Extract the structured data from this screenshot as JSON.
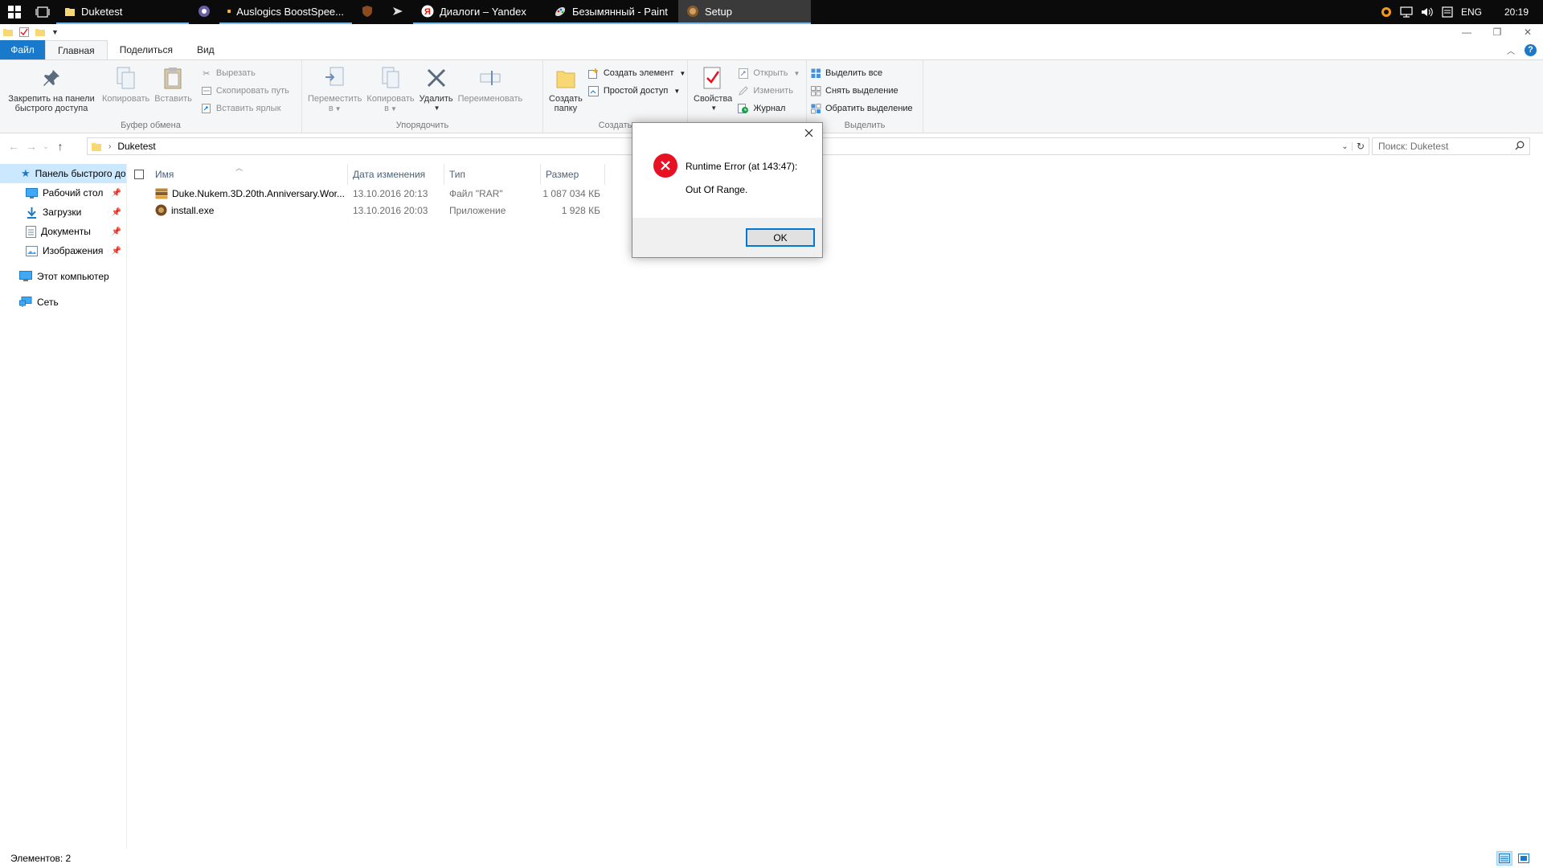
{
  "taskbar": {
    "items": [
      {
        "label": "Duketest",
        "icon": "folder-icon",
        "state": "running"
      },
      {
        "label": "",
        "icon": "app-circle-icon",
        "state": "pinned"
      },
      {
        "label": "Auslogics BoostSpee...",
        "icon": "boostspeed-icon",
        "state": "running"
      },
      {
        "label": "",
        "icon": "app-shield-icon",
        "state": "pinned"
      },
      {
        "label": "",
        "icon": "app-plane-icon",
        "state": "pinned"
      },
      {
        "label": "Диалоги – Yandex",
        "icon": "yandex-icon",
        "state": "running"
      },
      {
        "label": "Безымянный - Paint",
        "icon": "paint-icon",
        "state": "running"
      },
      {
        "label": "Setup",
        "icon": "setup-icon",
        "state": "active"
      }
    ],
    "tray": {
      "language": "ENG",
      "time": "20:19"
    }
  },
  "ribbon": {
    "tabs": {
      "file": "Файл",
      "home": "Главная",
      "share": "Поделиться",
      "view": "Вид"
    },
    "clipboard": {
      "label": "Буфер обмена",
      "pin_line1": "Закрепить на панели",
      "pin_line2": "быстрого доступа",
      "copy": "Копировать",
      "paste": "Вставить",
      "cut": "Вырезать",
      "copy_path": "Скопировать путь",
      "paste_shortcut": "Вставить ярлык"
    },
    "organize": {
      "label": "Упорядочить",
      "move_line1": "Переместить",
      "move_line2": "в",
      "copy_line1": "Копировать",
      "copy_line2": "в",
      "delete": "Удалить",
      "rename": "Переименовать"
    },
    "create": {
      "label": "Создать",
      "new_folder_line1": "Создать",
      "new_folder_line2": "папку",
      "new_item": "Создать элемент",
      "easy_access": "Простой доступ"
    },
    "open": {
      "properties": "Свойства",
      "open": "Открыть",
      "edit": "Изменить",
      "history": "Журнал"
    },
    "select": {
      "label": "Выделить",
      "select_all": "Выделить все",
      "select_none": "Снять выделение",
      "invert": "Обратить выделение"
    }
  },
  "address": {
    "path": "Duketest",
    "search_placeholder": "Поиск: Duketest"
  },
  "navpane": {
    "items": [
      {
        "label": "Панель быстрого доступа",
        "icon": "star-icon",
        "pinned": false
      },
      {
        "label": "Рабочий стол",
        "icon": "desktop-icon",
        "pinned": true
      },
      {
        "label": "Загрузки",
        "icon": "download-icon",
        "pinned": true
      },
      {
        "label": "Документы",
        "icon": "documents-icon",
        "pinned": true
      },
      {
        "label": "Изображения",
        "icon": "pictures-icon",
        "pinned": true
      },
      {
        "label": "Этот компьютер",
        "icon": "computer-icon",
        "pinned": false
      },
      {
        "label": "Сеть",
        "icon": "network-icon",
        "pinned": false
      }
    ]
  },
  "filelist": {
    "columns": {
      "name": "Имя",
      "date": "Дата изменения",
      "type": "Тип",
      "size": "Размер"
    },
    "rows": [
      {
        "name": "Duke.Nukem.3D.20th.Anniversary.Wor...",
        "date": "13.10.2016 20:13",
        "type": "Файл \"RAR\"",
        "size": "1 087 034 КБ",
        "icon": "rar-archive-icon"
      },
      {
        "name": "install.exe",
        "date": "13.10.2016 20:03",
        "type": "Приложение",
        "size": "1 928 КБ",
        "icon": "exe-app-icon"
      }
    ]
  },
  "statusbar": {
    "count": "Элементов: 2"
  },
  "dialog": {
    "message_line1": "Runtime Error (at 143:47):",
    "message_line2": "Out Of Range.",
    "ok_label": "OK",
    "icon": "error-icon"
  },
  "colors": {
    "accent": "#1979ca",
    "selection": "#cce8ff",
    "error": "#e81123",
    "taskbar": "#0b0b0b"
  }
}
